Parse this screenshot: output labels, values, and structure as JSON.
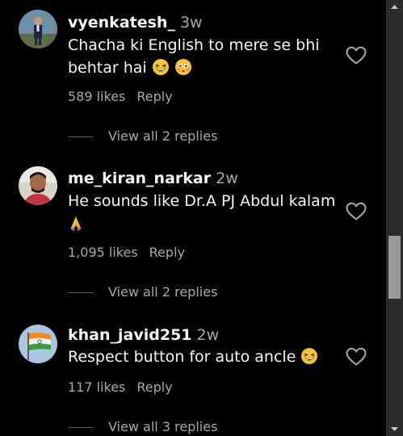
{
  "comments": [
    {
      "username": "vyenkatesh_",
      "time": "3w",
      "text": "Chacha ki English to mere se bhi behtar hai",
      "likes": "589 likes",
      "reply_label": "Reply",
      "view_replies": "View all 2 replies",
      "avatar": "avatar-man-in-suit",
      "emojis": [
        "grinning-squinting-face-emoji",
        "flushed-face-emoji"
      ]
    },
    {
      "username": "me_kiran_narkar",
      "time": "2w",
      "text": "He sounds like Dr.A PJ Abdul kalam",
      "likes": "1,095 likes",
      "reply_label": "Reply",
      "view_replies": "View all 2 replies",
      "avatar": "avatar-young-man",
      "emojis": [
        "folded-hands-emoji"
      ]
    },
    {
      "username": "khan_javid251",
      "time": "2w",
      "text": "Respect button for auto ancle",
      "likes": "117 likes",
      "reply_label": "Reply",
      "view_replies": "View all 3 replies",
      "avatar": "avatar-india-flag",
      "emojis": [
        "grinning-squinting-face-emoji"
      ]
    }
  ],
  "icons": {
    "like": "heart-outline-icon",
    "scroll_up": "scroll-up-arrow-icon",
    "scroll_down": "scroll-down-arrow-icon"
  },
  "colors": {
    "background": "#000000",
    "primary_text": "#f5f5f5",
    "secondary_text": "#a8a8a8",
    "scrollbar_track": "#2b2b2b",
    "scrollbar_thumb": "#9a9a9a"
  }
}
